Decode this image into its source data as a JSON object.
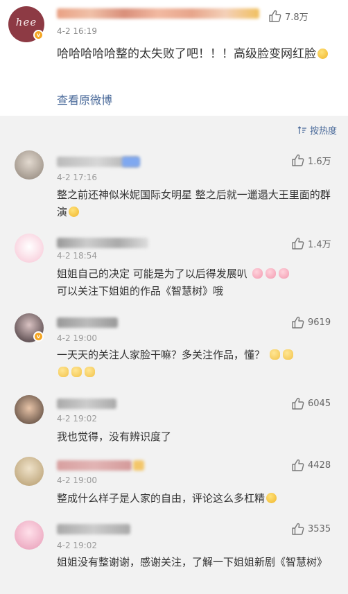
{
  "post": {
    "avatar_text": "hee",
    "time": "4-2 16:19",
    "likes": "7.8万",
    "text": "哈哈哈哈哈整的太失败了吧！！！高级脸变网红脸",
    "view_original": "查看原微博"
  },
  "sort_label": "按热度",
  "comments": [
    {
      "time": "4-2 17:16",
      "likes": "1.6万",
      "text": "整之前还神似米妮国际女明星 整之后就一邋遢大王里面的群演"
    },
    {
      "time": "4-2 18:54",
      "likes": "1.4万",
      "text": "姐姐自己的决定 可能是为了以后得发展叭",
      "text2": "可以关注下姐姐的作品《智慧树》哦"
    },
    {
      "time": "4-2 19:00",
      "likes": "9619",
      "text": "一天天的关注人家脸干嘛？多关注作品，懂？"
    },
    {
      "time": "4-2 19:02",
      "likes": "6045",
      "text": "我也觉得，没有辨识度了"
    },
    {
      "time": "4-2 19:00",
      "likes": "4428",
      "text": "整成什么样子是人家的自由，评论这么多杠精"
    },
    {
      "time": "4-2 19:02",
      "likes": "3535",
      "text": "姐姐没有整谢谢，感谢关注，了解一下姐姐新剧《智慧树》"
    }
  ],
  "colors": {
    "link": "#4a6a9a",
    "bg": "#f2f2f2",
    "badge": "#f5a623"
  },
  "icons": [
    "thumbs-up-icon",
    "sort-icon",
    "verified-badge-icon"
  ]
}
